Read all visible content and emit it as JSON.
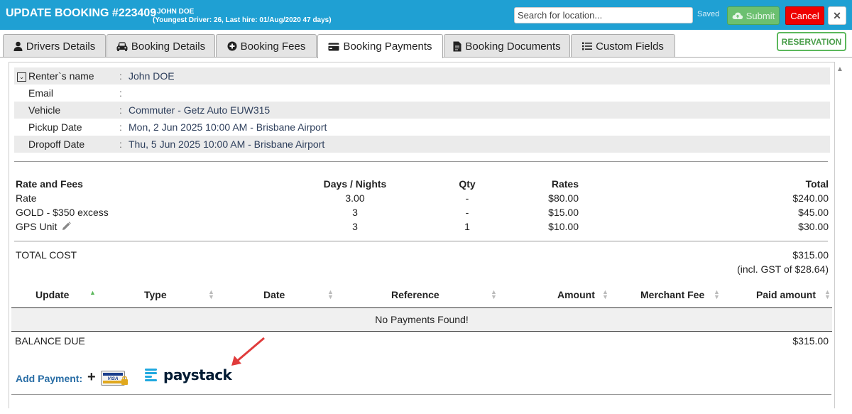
{
  "header": {
    "title": "UPDATE BOOKING #223409",
    "driver_name": "- JOHN DOE",
    "driver_info": "(Youngest Driver: 26, Last hire: 01/Aug/2020 47 days)",
    "search_placeholder": "Search for location...",
    "saved_label": "Saved",
    "submit_label": "Submit",
    "cancel_label": "Cancel",
    "close_label": "✕"
  },
  "tabs": [
    {
      "label": "Drivers Details",
      "icon": "user-icon"
    },
    {
      "label": "Booking Details",
      "icon": "car-icon"
    },
    {
      "label": "Booking Fees",
      "icon": "plus-circle-icon"
    },
    {
      "label": "Booking Payments",
      "icon": "credit-card-icon",
      "active": true
    },
    {
      "label": "Booking Documents",
      "icon": "document-icon"
    },
    {
      "label": "Custom Fields",
      "icon": "list-icon"
    }
  ],
  "reservation_label": "RESERVATION",
  "renter": {
    "rows": [
      {
        "label": "Renter`s name",
        "value": "John DOE"
      },
      {
        "label": "Email",
        "value": ""
      },
      {
        "label": "Vehicle",
        "value": "Commuter - Getz Auto EUW315"
      },
      {
        "label": "Pickup Date",
        "value": "Mon, 2 Jun 2025 10:00 AM - Brisbane Airport"
      },
      {
        "label": "Dropoff Date",
        "value": "Thu, 5 Jun 2025 10:00 AM - Brisbane Airport"
      }
    ]
  },
  "fees": {
    "headers": {
      "name": "Rate and Fees",
      "days": "Days / Nights",
      "qty": "Qty",
      "rates": "Rates",
      "total": "Total"
    },
    "rows": [
      {
        "name": "Rate",
        "days": "3.00",
        "qty": "-",
        "rate": "$80.00",
        "total": "$240.00"
      },
      {
        "name": "GOLD - $350 excess",
        "days": "3",
        "qty": "-",
        "rate": "$15.00",
        "total": "$45.00"
      },
      {
        "name": "GPS Unit",
        "days": "3",
        "qty": "1",
        "rate": "$10.00",
        "total": "$30.00"
      }
    ],
    "total_label": "TOTAL COST",
    "total_value": "$315.00",
    "gst_note": "(incl. GST of $28.64)"
  },
  "payments": {
    "columns": [
      "Update",
      "Type",
      "Date",
      "Reference",
      "Amount",
      "Merchant Fee",
      "Paid amount"
    ],
    "empty_message": "No Payments Found!"
  },
  "balance": {
    "label": "BALANCE DUE",
    "value": "$315.00"
  },
  "add_payment_label": "Add Payment:",
  "plus_symbol": "+",
  "visa_text": "VISA",
  "paystack_label": "paystack",
  "colors": {
    "header_bg": "#1fa0d3",
    "accent_green": "#5cb85c",
    "cancel_red": "#e00000",
    "link_blue": "#2a6ea6",
    "arrow_red": "#e03b3b"
  }
}
